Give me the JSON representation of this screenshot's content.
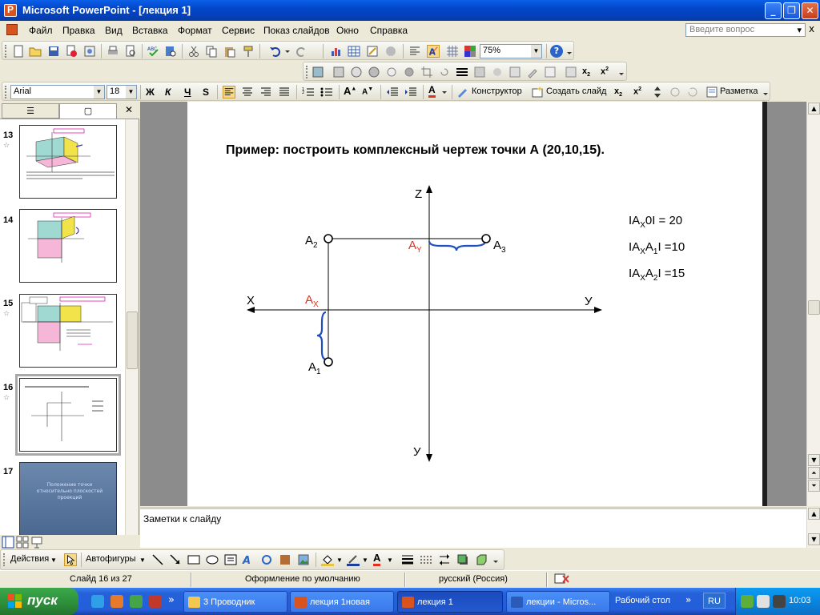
{
  "window": {
    "title": "Microsoft PowerPoint - [лекция 1]",
    "min_glyph": "_",
    "max_glyph": "❐",
    "close_glyph": "✕"
  },
  "menu": {
    "items": [
      "Файл",
      "Правка",
      "Вид",
      "Вставка",
      "Формат",
      "Сервис",
      "Показ слайдов",
      "Окно",
      "Справка"
    ],
    "help_placeholder": "Введите вопрос",
    "help_dropdown": "▾",
    "doc_close": "x"
  },
  "standard_toolbar": {
    "zoom": "75%",
    "help_glyph": "?"
  },
  "formatting_toolbar": {
    "font": "Arial",
    "font_size": "18",
    "bold": "Ж",
    "italic": "К",
    "underline": "Ч",
    "shadow": "S",
    "design_label": "Конструктор",
    "new_slide_label": "Создать слайд",
    "layout_label": "Разметка"
  },
  "pane_tabs": {
    "outline_glyph": "☰",
    "slides_glyph": "▢"
  },
  "thumbnails": [
    {
      "number": "13",
      "has_star": true
    },
    {
      "number": "14",
      "has_star": false
    },
    {
      "number": "15",
      "has_star": true
    },
    {
      "number": "16",
      "has_star": true,
      "selected": true
    },
    {
      "number": "17",
      "has_star": false,
      "text": "Положение точки относительно плоскостей проекций"
    }
  ],
  "slide": {
    "heading": "Пример:  построить комплексный чертеж точки А (20,10,15).",
    "axis_z": "Z",
    "axis_x": "X",
    "axis_y_right": "У",
    "axis_y_bottom": "У",
    "label_A2": "А",
    "label_A2_sub": "2",
    "label_A3": "А",
    "label_A3_sub": "3",
    "label_A1": "А",
    "label_A1_sub": "1",
    "label_Ax": "А",
    "label_Ax_sub": "X",
    "label_Ay": "А",
    "label_Ay_sub": "Y",
    "eq1": {
      "a": "IА",
      "a_sub": "X",
      "b": "0I  = 20"
    },
    "eq2": {
      "a": "IА",
      "a_sub": "X",
      "b": "А",
      "b_sub": "1",
      "c": "I =10"
    },
    "eq3": {
      "a": "IА",
      "a_sub": "X",
      "b": "А",
      "b_sub": "2",
      "c": "I =15"
    }
  },
  "notes_placeholder": "Заметки к слайду",
  "drawing_toolbar": {
    "actions_label": "Действия",
    "autoshapes_label": "Автофигуры"
  },
  "status_bar": {
    "slide_info": "Слайд 16 из 27",
    "design": "Оформление по умолчанию",
    "language": "русский (Россия)"
  },
  "taskbar": {
    "start_label": "пуск",
    "tasks": [
      {
        "label": "3 Проводник",
        "active": false
      },
      {
        "label": "лекция 1новая",
        "active": false
      },
      {
        "label": "лекция 1",
        "active": true
      },
      {
        "label": "лекции - Micros...",
        "active": false
      }
    ],
    "desktop_label": "Рабочий стол",
    "desktop_arrow": "»",
    "lang": "RU",
    "clock": "10:03"
  },
  "colors": {
    "accent_red": "#e0301e",
    "bracket_blue": "#1f4fbf",
    "title_blue": "#0a5fe8"
  }
}
